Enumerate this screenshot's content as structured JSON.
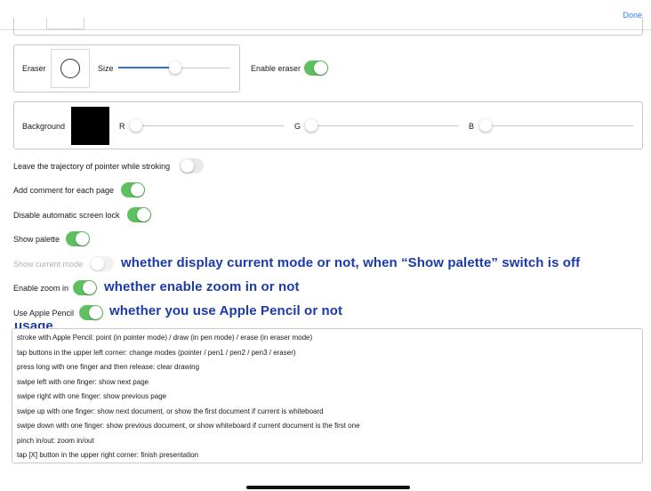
{
  "nav": {
    "done_label": "Done"
  },
  "eraser_panel": {
    "eraser_label": "Eraser",
    "size_label": "Size",
    "size_value": 0.52,
    "enable_eraser_label": "Enable eraser",
    "enable_eraser_on": true
  },
  "background_panel": {
    "label": "Background",
    "color": "#000000",
    "r_label": "R",
    "g_label": "G",
    "b_label": "B",
    "r_value": 0,
    "g_value": 0,
    "b_value": 0
  },
  "settings": [
    {
      "label": "Leave the trajectory of pointer while stroking",
      "on": false,
      "disabled": false
    },
    {
      "label": "Add comment for each page",
      "on": true,
      "disabled": false
    },
    {
      "label": "Disable automatic screen lock",
      "on": true,
      "disabled": false
    },
    {
      "label": "Show palette",
      "on": true,
      "disabled": false
    },
    {
      "label": "Show current mode",
      "on": false,
      "disabled": true
    },
    {
      "label": "Enable zoom in",
      "on": true,
      "disabled": false
    },
    {
      "label": "Use Apple Pencil",
      "on": true,
      "disabled": false
    }
  ],
  "annotations": {
    "show_current_mode": "whether display current mode or not, when “Show palette” switch is off",
    "enable_zoom": "whether enable zoom in or not",
    "apple_pencil": "whether you use Apple Pencil or not",
    "usage": "usage"
  },
  "usage_lines": [
    "stroke with Apple Pencil: point (in pointer mode) / draw (in pen mode) / erase (in eraser mode)",
    "tap buttons in the upper left corner: change modes (pointer / pen1 / pen2 / pen3 / eraser)",
    "press long with one finger and then release: clear drawing",
    "swipe left with one finger: show next page",
    "swipe right with one finger: show previous page",
    "swipe up with one finger: show next document, or show the first document if current is whiteboard",
    "swipe down with one finger: show previous document, or show whiteboard if current document is the first one",
    "pinch in/out: zoom in/out",
    "tap [X] button in the upper right corner: finish presentation"
  ],
  "colors": {
    "accent": "#2f6fe0",
    "toggle_on": "#5fc05f",
    "annotation": "#1c3aa9"
  }
}
